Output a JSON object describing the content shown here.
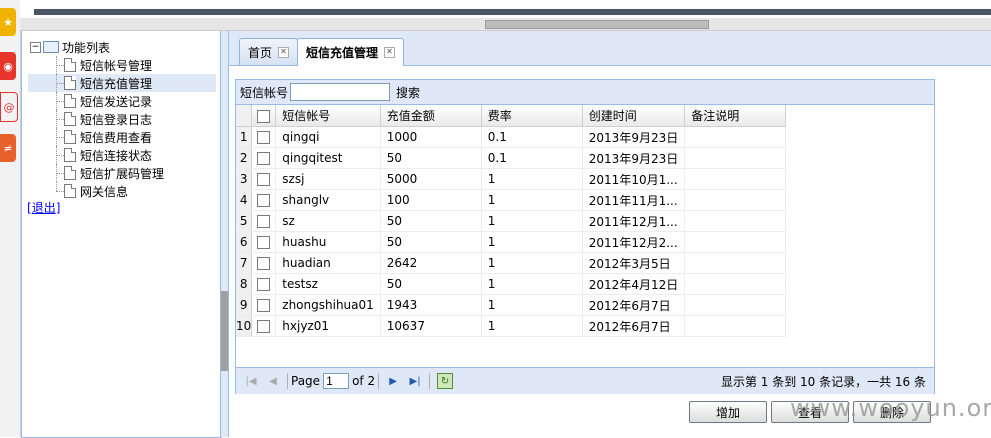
{
  "tree": {
    "root_label": "功能列表",
    "items": [
      {
        "label": "短信帐号管理"
      },
      {
        "label": "短信充值管理"
      },
      {
        "label": "短信发送记录"
      },
      {
        "label": "短信登录日志"
      },
      {
        "label": "短信费用查看"
      },
      {
        "label": "短信连接状态"
      },
      {
        "label": "短信扩展码管理"
      },
      {
        "label": "网关信息"
      }
    ],
    "logout_label": "退出"
  },
  "tabs": [
    {
      "label": "首页"
    },
    {
      "label": "短信充值管理"
    }
  ],
  "search": {
    "label": "短信帐号",
    "value": "",
    "button_label": "搜索"
  },
  "table": {
    "columns": [
      "短信帐号",
      "充值金额",
      "费率",
      "创建时间",
      "备注说明"
    ],
    "rows": [
      {
        "n": "1",
        "account": "qingqi",
        "amount": "1000",
        "rate": "0.1",
        "created": "2013年9月23日",
        "note": ""
      },
      {
        "n": "2",
        "account": "qingqitest",
        "amount": "50",
        "rate": "0.1",
        "created": "2013年9月23日",
        "note": ""
      },
      {
        "n": "3",
        "account": "szsj",
        "amount": "5000",
        "rate": "1",
        "created": "2011年10月1...",
        "note": ""
      },
      {
        "n": "4",
        "account": "shanglv",
        "amount": "100",
        "rate": "1",
        "created": "2011年11月1...",
        "note": ""
      },
      {
        "n": "5",
        "account": "sz",
        "amount": "50",
        "rate": "1",
        "created": "2011年12月1...",
        "note": ""
      },
      {
        "n": "6",
        "account": "huashu",
        "amount": "50",
        "rate": "1",
        "created": "2011年12月2...",
        "note": ""
      },
      {
        "n": "7",
        "account": "huadian",
        "amount": "2642",
        "rate": "1",
        "created": "2012年3月5日",
        "note": ""
      },
      {
        "n": "8",
        "account": "testsz",
        "amount": "50",
        "rate": "1",
        "created": "2012年4月12日",
        "note": ""
      },
      {
        "n": "9",
        "account": "zhongshihua01",
        "amount": "1943",
        "rate": "1",
        "created": "2012年6月7日",
        "note": ""
      },
      {
        "n": "10",
        "account": "hxjyz01",
        "amount": "10637",
        "rate": "1",
        "created": "2012年6月7日",
        "note": ""
      }
    ]
  },
  "pager": {
    "page_label": "Page",
    "current_page": "1",
    "of_label": "of 2",
    "info": "显示第 1 条到 10 条记录，一共 16 条"
  },
  "buttons": {
    "add": "增加",
    "view": "查看",
    "delete": "删除"
  },
  "watermark": "www.wooyun.org",
  "colors": {
    "panel_border": "#99bbe8",
    "panel_bg": "#dfe8f6",
    "link": "#0000ff"
  }
}
